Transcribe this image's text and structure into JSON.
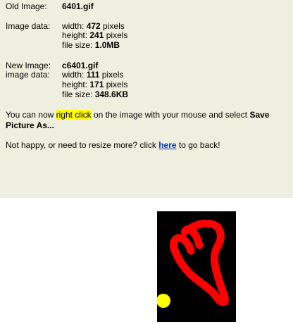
{
  "old_image": {
    "label": "Old Image:",
    "filename": "6401.gif",
    "data_label": "Image data:",
    "width_prefix": "width: ",
    "width_value": "472",
    "height_prefix": "height: ",
    "height_value": "241",
    "unit": " pixels",
    "size_prefix": "file size: ",
    "size_value": "1.0MB"
  },
  "new_image": {
    "label": "New Image:",
    "filename": "c6401.gif",
    "data_label": "image data:",
    "width_prefix": "width: ",
    "width_value": "111",
    "height_prefix": "height: ",
    "height_value": "171",
    "unit": " pixels",
    "size_prefix": "file size: ",
    "size_value": "348.6KB"
  },
  "instructions": {
    "part1": "You can now ",
    "highlight": "right click",
    "part2": " on the image with your mouse and select ",
    "bold_line1": "Save",
    "bold_line2": "Picture As..."
  },
  "back": {
    "prefix": "Not happy, or need to resize more? click ",
    "link": "here",
    "suffix": " to go back!"
  },
  "colors": {
    "panel_bg": "#efefdf",
    "highlight": "#ffff00",
    "link": "#0033cc",
    "heart": "#ff0000",
    "dot": "#ffff00",
    "image_bg": "#000000"
  }
}
